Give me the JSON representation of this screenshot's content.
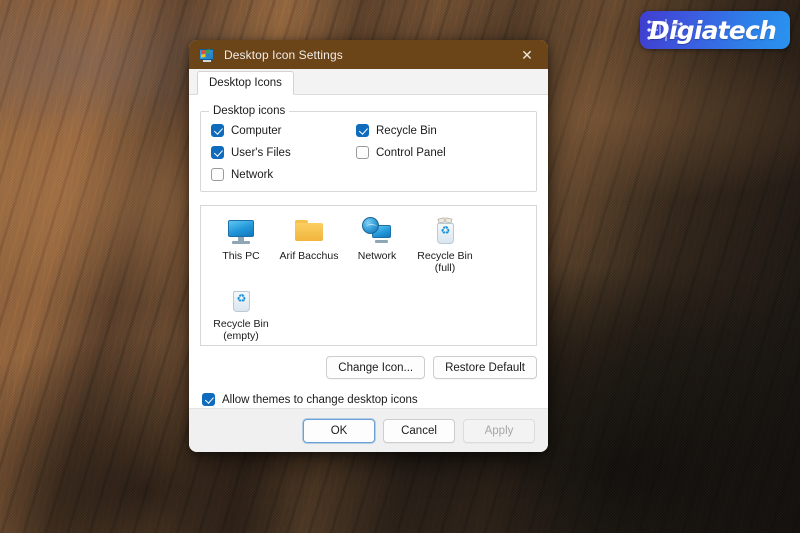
{
  "wallpaper": {
    "description": "rocky mountain ridges desert landscape",
    "colors": [
      "#7d5736",
      "#4a3524",
      "#221a13"
    ]
  },
  "logo": {
    "text": "Digiatech",
    "icon": "circuit-board-icon",
    "gradient_from": "#3f3ed0",
    "gradient_to": "#2a93ef"
  },
  "dialog": {
    "title": "Desktop Icon Settings",
    "title_icon": "desktop-settings-icon",
    "close_icon": "✕",
    "titlebar_color": "#6b4417",
    "tabs": [
      {
        "label": "Desktop Icons",
        "selected": true
      }
    ],
    "group": {
      "legend": "Desktop icons",
      "checkboxes": [
        {
          "label": "Computer",
          "checked": true
        },
        {
          "label": "Recycle Bin",
          "checked": true
        },
        {
          "label": "User's Files",
          "checked": true
        },
        {
          "label": "Control Panel",
          "checked": false
        },
        {
          "label": "Network",
          "checked": false
        }
      ]
    },
    "preview": {
      "icons": [
        {
          "label": "This PC",
          "icon": "this-pc-icon"
        },
        {
          "label": "Arif Bacchus",
          "icon": "user-folder-icon"
        },
        {
          "label": "Network",
          "icon": "network-icon"
        },
        {
          "label": "Recycle Bin\n(full)",
          "icon": "recycle-bin-full-icon"
        },
        {
          "label": "Recycle Bin\n(empty)",
          "icon": "recycle-bin-empty-icon"
        }
      ]
    },
    "actions": {
      "change_icon": "Change Icon...",
      "restore_default": "Restore Default"
    },
    "themes_option": {
      "label": "Allow themes to change desktop icons",
      "checked": true
    },
    "footer": {
      "ok": "OK",
      "cancel": "Cancel",
      "apply": "Apply",
      "apply_disabled": true,
      "focus_accent": "#6aa2d8"
    }
  }
}
